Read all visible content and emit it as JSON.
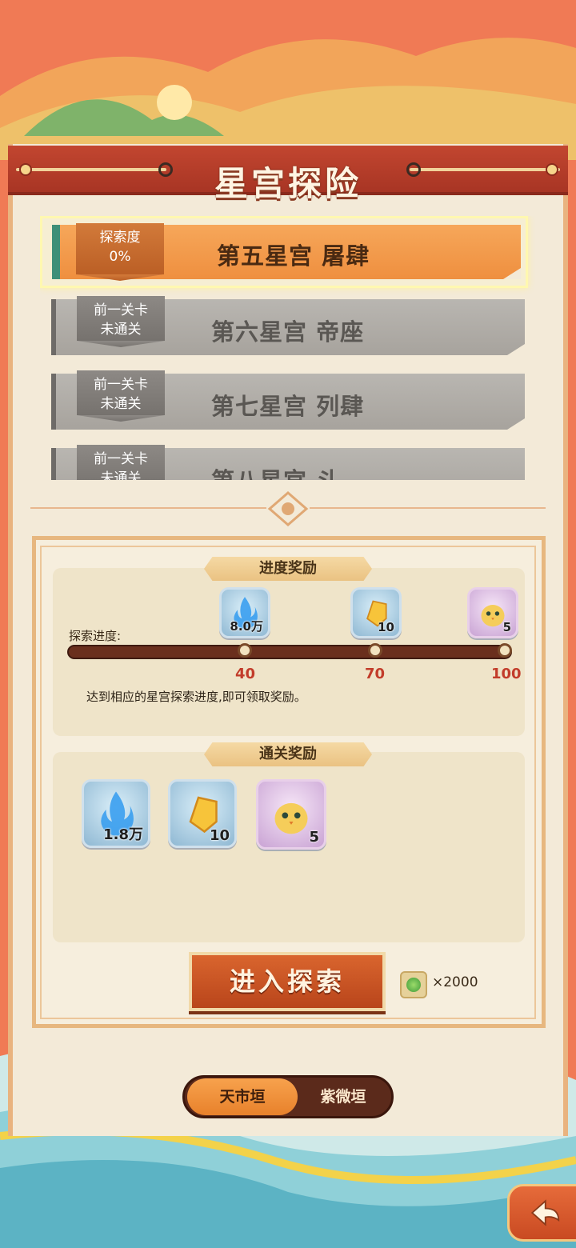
{
  "title": "星宫探险",
  "levels": [
    {
      "name": "第五星宫  屠肆",
      "status_line1": "探索度",
      "status_line2": "0%"
    },
    {
      "name": "第六星宫  帝座",
      "status_line1": "前一关卡",
      "status_line2": "未通关"
    },
    {
      "name": "第七星宫  列肆",
      "status_line1": "前一关卡",
      "status_line2": "未通关"
    },
    {
      "name": "第八星宫  斗",
      "status_line1": "前一关卡",
      "status_line2": "未通关"
    }
  ],
  "progress_rewards": {
    "header": "进度奖励",
    "label": "探索进度:",
    "progress_percent": 0,
    "milestones": [
      "40",
      "70",
      "100"
    ],
    "items": [
      {
        "icon": "blue-flame-icon",
        "count": "8.0万"
      },
      {
        "icon": "gold-crystal-icon",
        "count": "10"
      },
      {
        "icon": "chick-pet-icon",
        "count": "5"
      }
    ],
    "hint": "达到相应的星宫探索进度,即可领取奖励。"
  },
  "clear_rewards": {
    "header": "通关奖励",
    "items": [
      {
        "icon": "blue-flame-icon",
        "count": "1.8万"
      },
      {
        "icon": "gold-crystal-icon",
        "count": "10"
      },
      {
        "icon": "chick-pet-icon",
        "count": "5"
      }
    ]
  },
  "enter_button": "进入探索",
  "cost": "×2000",
  "tabs": [
    "天市垣",
    "紫微垣"
  ],
  "active_tab": "天市垣",
  "colors": {
    "accent": "#e8812b",
    "banner": "#b23b27",
    "locked": "#a9a59f"
  }
}
